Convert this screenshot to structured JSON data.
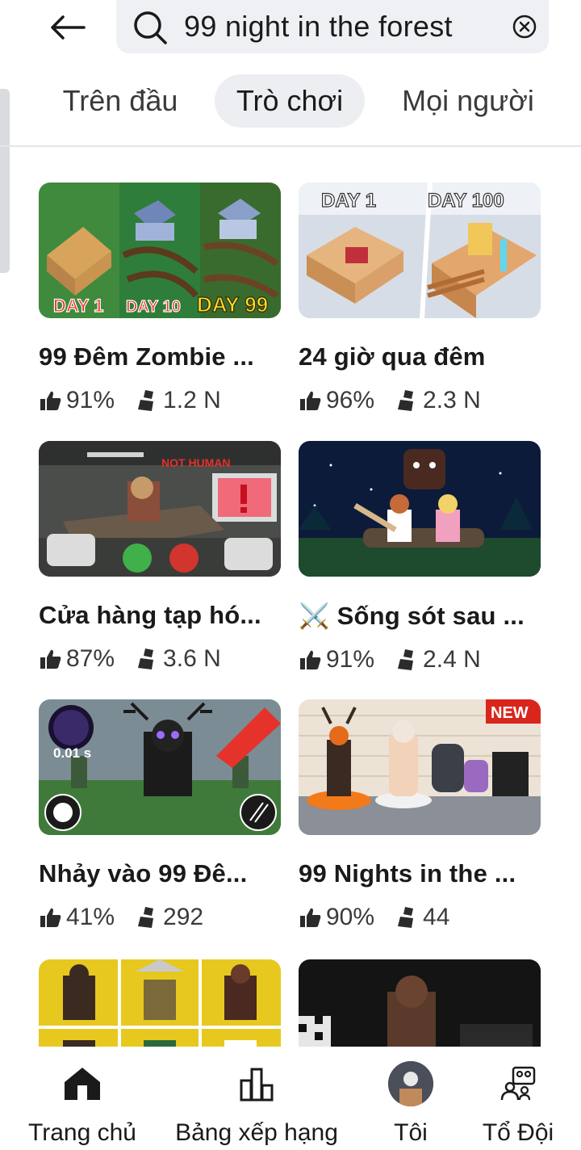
{
  "search": {
    "query": "99 night in the forest"
  },
  "tabs": [
    {
      "label": "Trên đầu",
      "active": false
    },
    {
      "label": "Trò chơi",
      "active": true
    },
    {
      "label": "Mọi người",
      "active": false
    }
  ],
  "games": [
    {
      "title": "99 Đêm Zombie ...",
      "rating": "91%",
      "players": "1.2 N",
      "thumb_text": [
        "DAY 1",
        "DAY 10",
        "DAY 99"
      ]
    },
    {
      "title": "24 giờ qua đêm",
      "rating": "96%",
      "players": "2.3 N",
      "thumb_text": [
        "DAY 1",
        "DAY 100"
      ]
    },
    {
      "title": "Cửa hàng tạp hó...",
      "rating": "87%",
      "players": "3.6 N",
      "thumb_text": [
        "NOT HUMAN"
      ]
    },
    {
      "title": "⚔️ Sống sót sau ...",
      "rating": "91%",
      "players": "2.4 N",
      "thumb_text": []
    },
    {
      "title": "Nhảy vào 99 Đê...",
      "rating": "41%",
      "players": "292",
      "thumb_text": [
        "0.01 s"
      ]
    },
    {
      "title": "99 Nights in the ...",
      "rating": "90%",
      "players": "44",
      "thumb_text": [
        "NEW"
      ]
    }
  ],
  "bottom_nav": [
    {
      "label": "Trang chủ",
      "icon": "home-icon"
    },
    {
      "label": "Bảng xếp hạng",
      "icon": "leaderboard-icon"
    },
    {
      "label": "Tôi",
      "icon": "avatar"
    },
    {
      "label": "Tổ Đội",
      "icon": "party-icon"
    }
  ],
  "colors": {
    "search_bg": "#eef0f3",
    "active_tab_bg": "#eceef1",
    "text": "#1a1a1a"
  }
}
